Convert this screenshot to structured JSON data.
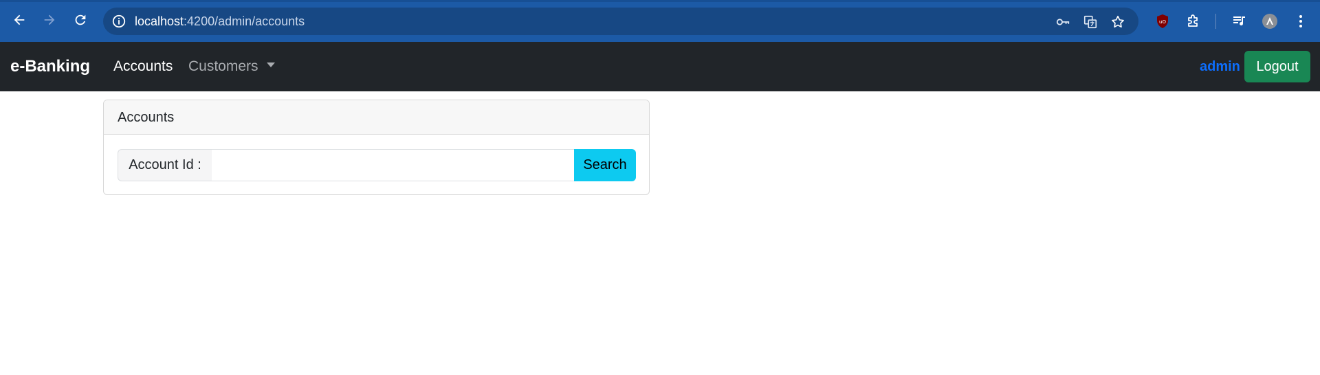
{
  "browser": {
    "url_host": "localhost",
    "url_path": ":4200/admin/accounts",
    "icons": [
      "back-arrow-icon",
      "forward-arrow-icon",
      "reload-icon",
      "site-info-icon",
      "password-key-icon",
      "translate-icon",
      "bookmark-star-icon",
      "ublock-icon",
      "extensions-puzzle-icon",
      "media-queue-icon",
      "profile-avatar-icon",
      "more-menu-icon"
    ]
  },
  "navbar": {
    "brand": "e-Banking",
    "links": [
      {
        "label": "Accounts"
      },
      {
        "label": "Customers"
      }
    ],
    "user": "admin",
    "logout_label": "Logout"
  },
  "card": {
    "title": "Accounts",
    "search": {
      "label": "Account Id :",
      "value": "",
      "button_label": "Search"
    }
  },
  "colors": {
    "browser_bar": "#1c5aa6",
    "navbar": "#212529",
    "user_link": "#0d6efd",
    "logout_button": "#198754",
    "search_button": "#0dcaf0"
  }
}
